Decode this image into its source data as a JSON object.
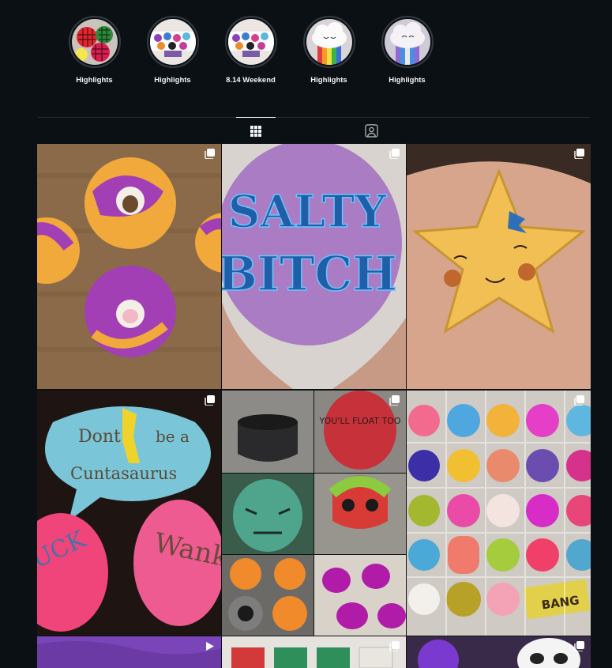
{
  "highlights": [
    {
      "label": "Highlights",
      "icon": "highlight-cover-checkered-bath-bombs"
    },
    {
      "label": "Highlights",
      "icon": "highlight-cover-colorful-bath-bombs"
    },
    {
      "label": "8.14 Weekend",
      "icon": "highlight-cover-colorful-bath-bombs"
    },
    {
      "label": "Highlights",
      "icon": "highlight-cover-rainbow-cloud"
    },
    {
      "label": "Highlights",
      "icon": "highlight-cover-rainbow-cloud"
    }
  ],
  "tabs": [
    {
      "name": "posts",
      "icon": "grid-icon",
      "active": true
    },
    {
      "name": "tagged",
      "icon": "tagged-person-icon",
      "active": false
    }
  ],
  "posts": {
    "p2_line1": "SALTY",
    "p2_line2": "BITCH",
    "p4_line1": "Dont",
    "p4_line2": "be a",
    "p4_line3": "Cuntasaurus",
    "p4_word": "Wank",
    "p4_pink": "UCK",
    "p5_text": "YOU'LL FLOAT TOO",
    "p6_text": "BANG"
  },
  "badges": [
    "carousel-icon",
    "carousel-icon",
    "carousel-icon",
    "carousel-icon",
    "carousel-icon",
    "carousel-icon",
    "reel-icon",
    "carousel-icon",
    "carousel-icon"
  ],
  "colors": {
    "background": "#0b1014",
    "text": "#f5f5f5",
    "divider": "#262b30"
  }
}
